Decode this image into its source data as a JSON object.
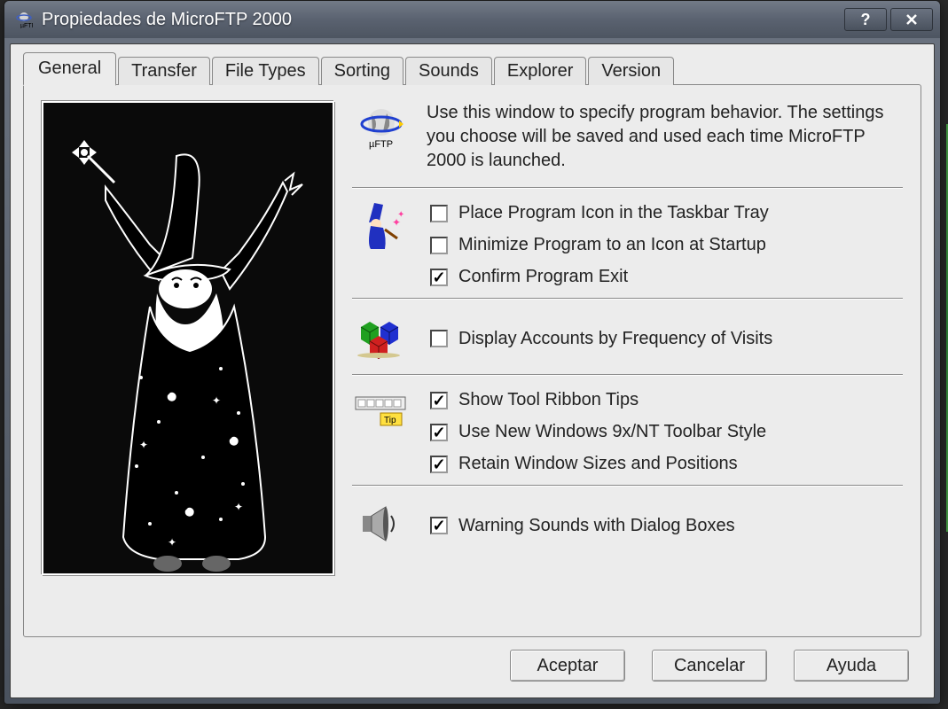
{
  "window": {
    "title": "Propiedades de MicroFTP 2000"
  },
  "tabs": [
    "General",
    "Transfer",
    "File Types",
    "Sorting",
    "Sounds",
    "Explorer",
    "Version"
  ],
  "intro": "Use this window to specify program behavior. The settings you choose will be saved and used each time MicroFTP 2000 is launched.",
  "ftp_label": "µFTP",
  "options": {
    "group1": [
      {
        "label": "Place Program Icon in the Taskbar Tray",
        "checked": false
      },
      {
        "label": "Minimize Program to an Icon at Startup",
        "checked": false
      },
      {
        "label": "Confirm Program Exit",
        "checked": true
      }
    ],
    "group2": [
      {
        "label": "Display Accounts by Frequency of Visits",
        "checked": false
      }
    ],
    "group3": [
      {
        "label": "Show Tool Ribbon Tips",
        "checked": true
      },
      {
        "label": "Use New Windows 9x/NT Toolbar Style",
        "checked": true
      },
      {
        "label": "Retain Window Sizes and Positions",
        "checked": true
      }
    ],
    "group4": [
      {
        "label": "Warning Sounds with Dialog Boxes",
        "checked": true
      }
    ]
  },
  "buttons": {
    "ok": "Aceptar",
    "cancel": "Cancelar",
    "help": "Ayuda"
  }
}
